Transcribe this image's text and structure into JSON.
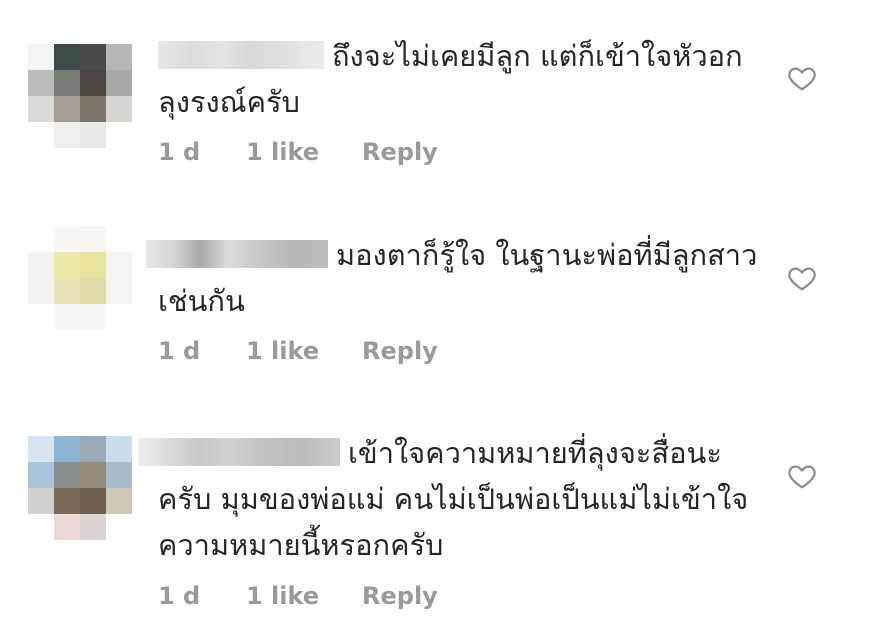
{
  "comments": [
    {
      "text": "ถึงจะไม่เคยมีลูก แต่ก็เข้าใจหัวอกลุงรงณ์ครับ",
      "time": "1 d",
      "likes": "1 like",
      "reply": "Reply"
    },
    {
      "text": "มองตาก็รู้ใจ ในฐานะพ่อที่มีลูกสาวเช่นกัน",
      "time": "1 d",
      "likes": "1 like",
      "reply": "Reply"
    },
    {
      "text": "เข้าใจความหมายที่ลุงจะสื่อนะครับ มุมของพ่อแม่ คนไม่เป็นพ่อเป็นแม่ไม่เข้าใจความหมายนี้หรอกครับ",
      "time": "1 d",
      "likes": "1 like",
      "reply": "Reply"
    }
  ],
  "icons": {
    "like": "heart-outline-icon"
  },
  "colors": {
    "text": "#262626",
    "meta": "#9a9a9a",
    "icon": "#8e8e8e"
  }
}
